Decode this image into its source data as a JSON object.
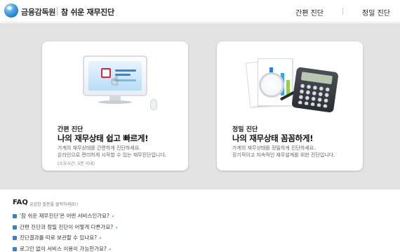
{
  "header": {
    "org_name": "금융감독원",
    "service_title": "참 쉬운 재무진단",
    "nav": {
      "simple": "간편 진단",
      "detail": "정밀 진단"
    }
  },
  "cards": {
    "simple": {
      "heading_small": "간편 진단",
      "heading_big": "나의 재무상태 쉽고 빠르게!",
      "description": "가계의 재무상태를 간편하게 진단하세요.\n온라인으로 편리하게 시작할 수 있는 재무진단입니다.",
      "note": "(소요시간: 5분 이내)"
    },
    "detail": {
      "heading_small": "정밀 진단",
      "heading_big": "나의 재무상태 꼼꼼하게!",
      "description": "가계의 재무상태를 정밀하게 진단하세요.\n장기적이고 지속적인 재무설계를 위한 진단입니다."
    }
  },
  "faq": {
    "title": "FAQ",
    "hint": "궁금한 질문을 클릭하세요!!",
    "items": [
      "'참 쉬운 재무진단'은 어떤 서비스인가요?",
      "간편 진단과 정밀 진단이 어떻게 다른가요?",
      "진단결과를 따로 보관할 수 있나요?",
      "로그인 없이 서비스 이용이 가능한가요?"
    ]
  },
  "colors": {
    "hero_bg": "#e3e3e3",
    "accent_blue": "#3a7fc8",
    "check_red": "#d7253a"
  }
}
